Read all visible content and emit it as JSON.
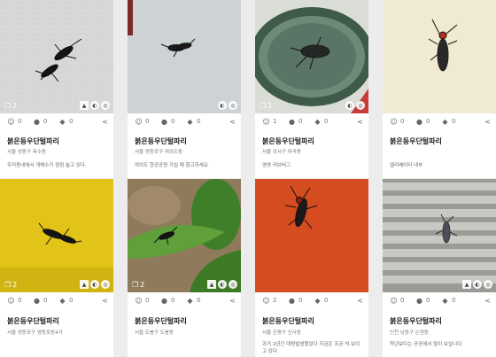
{
  "cards": [
    {
      "title": "붉은등우단털파리",
      "location": "서울 성동구 옥수동",
      "description": "우리동네에서 개체수가 점점 늘고 있다.",
      "photo_count": "2",
      "stats": {
        "views": "0",
        "comments": "0",
        "likes": "0"
      },
      "bg": "#d9d9d9"
    },
    {
      "title": "붉은등우단털파리",
      "location": "서울 영등포구 여의도동",
      "description": "여의도 한강공원 가실 때 참고하세요",
      "photo_count": "",
      "stats": {
        "views": "0",
        "comments": "0",
        "likes": "0"
      },
      "bg": "#cfd3d6"
    },
    {
      "title": "붉은등우단털파리",
      "location": "서울 강서구 마곡동",
      "description": "영영 러브버그",
      "photo_count": "2",
      "stats": {
        "views": "1",
        "comments": "0",
        "likes": "0"
      },
      "bg": "#c7d0c8"
    },
    {
      "title": "붉은등우단털파리",
      "location": "",
      "description": "엘리베이터 내부",
      "photo_count": "",
      "stats": {
        "views": "0",
        "comments": "0",
        "likes": "0"
      },
      "bg": "#efe8cf"
    },
    {
      "title": "붉은등우단털파리",
      "location": "서울 영등포구 영등포동4가",
      "description": "",
      "photo_count": "2",
      "stats": {
        "views": "0",
        "comments": "0",
        "likes": "0"
      },
      "bg": "#e2c418"
    },
    {
      "title": "붉은등우단털파리",
      "location": "서울 도봉구 도봉동",
      "description": "",
      "photo_count": "2",
      "stats": {
        "views": "0",
        "comments": "0",
        "likes": "0"
      },
      "bg": "#4f8a2f"
    },
    {
      "title": "붉은등우단털파리",
      "location": "서울 은평구 신사동",
      "description": "과거 2년간 대량발생했었다 지금은 조금 씩 보이고 있다.",
      "photo_count": "",
      "stats": {
        "views": "2",
        "comments": "0",
        "likes": "0"
      },
      "bg": "#d2451d"
    },
    {
      "title": "붉은등우단털파리",
      "location": "인천 남동구 논현동",
      "description": "작년보다는 공공에서 많이 보입니다.",
      "photo_count": "",
      "stats": {
        "views": "0",
        "comments": "0",
        "likes": "0"
      },
      "bg": "#9a9a96"
    }
  ],
  "icons": {
    "user": "user-icon",
    "comment": "comment-icon",
    "tag": "tag-icon",
    "share": "share-icon",
    "photos": "photos-icon"
  }
}
